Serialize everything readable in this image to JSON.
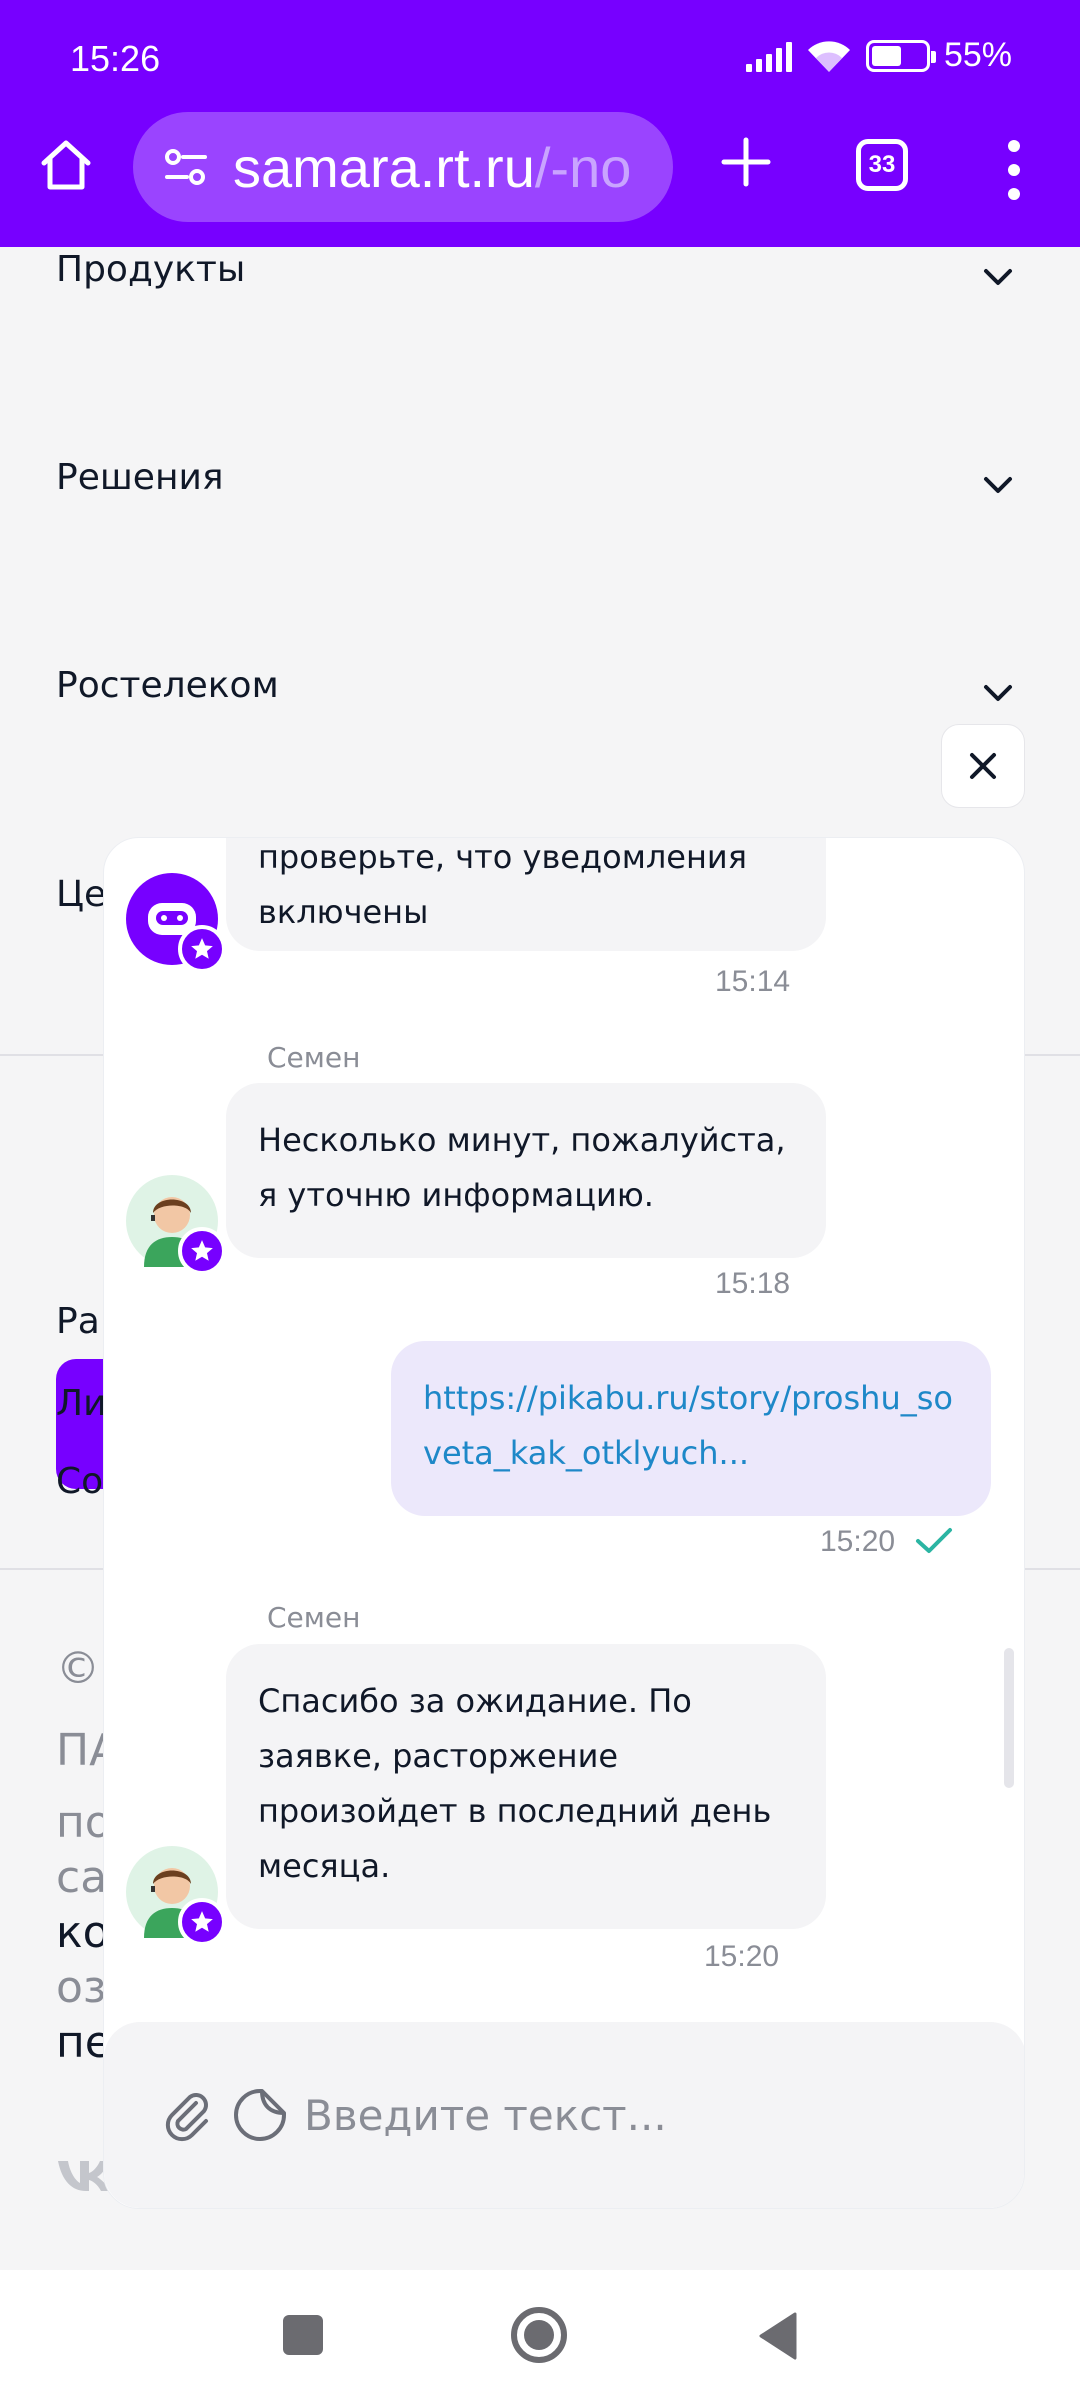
{
  "status_bar": {
    "time": "15:26",
    "battery": "55%",
    "battery_level": 0.55
  },
  "browser": {
    "url_host": "samara.rt.ru",
    "url_path": "/-no",
    "tabs_count": "33"
  },
  "page": {
    "nav_items": [
      {
        "label": "Продукты"
      },
      {
        "label": "Решения"
      },
      {
        "label": "Ростелеком"
      },
      {
        "label": "Це"
      }
    ],
    "footer_fragments": [
      "Ра",
      "Ли",
      "Со",
      "©",
      "ПА",
      "по",
      "са",
      "ко",
      "оз",
      "пе"
    ]
  },
  "chat": {
    "messages": [
      {
        "text": "проверьте, что уведомления включены",
        "time": "15:14",
        "avatar": "bot-avatar"
      },
      {
        "sender": "Семен",
        "text": "Несколько минут, пожалуйста, я уточню информацию.",
        "time": "15:18",
        "avatar": "operator-avatar"
      },
      {
        "text": "https://pikabu.ru/story/proshu_soveta_kak_otklyuch...",
        "time": "15:20",
        "mine": true,
        "status_icon": "check-icon"
      },
      {
        "sender": "Семен",
        "text": "Спасибо за ожидание. По заявке, расторжение произойдет в последний день месяца.",
        "time": "15:20",
        "avatar": "operator-avatar"
      }
    ],
    "input_placeholder": "Введите текст..."
  }
}
